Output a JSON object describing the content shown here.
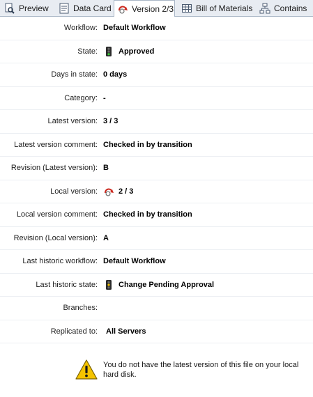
{
  "tabs": [
    {
      "label": "Preview",
      "icon": "preview-icon"
    },
    {
      "label": "Data Card",
      "icon": "data-card-icon"
    },
    {
      "label": "Version 2/3",
      "icon": "version-icon",
      "active": true
    },
    {
      "label": "Bill of Materials",
      "icon": "bom-table-icon"
    },
    {
      "label": "Contains",
      "icon": "contains-tree-icon"
    }
  ],
  "fields": {
    "workflow": {
      "label": "Workflow:",
      "value": "Default Workflow"
    },
    "state": {
      "label": "State:",
      "value": "Approved",
      "icon": "traffic-light-icon"
    },
    "days_in_state": {
      "label": "Days in state:",
      "value": "0 days"
    },
    "category": {
      "label": "Category:",
      "value": "-"
    },
    "latest_version": {
      "label": "Latest version:",
      "value": "3 / 3"
    },
    "latest_version_comment": {
      "label": "Latest version comment:",
      "value": "Checked in by transition"
    },
    "revision_latest": {
      "label": "Revision (Latest version):",
      "value": "B"
    },
    "local_version": {
      "label": "Local version:",
      "value": "2 / 3",
      "icon": "local-version-icon"
    },
    "local_version_comment": {
      "label": "Local version comment:",
      "value": "Checked in by transition"
    },
    "revision_local": {
      "label": "Revision (Local version):",
      "value": "A"
    },
    "last_historic_workflow": {
      "label": "Last historic workflow:",
      "value": "Default Workflow"
    },
    "last_historic_state": {
      "label": "Last historic state:",
      "value": "Change Pending Approval",
      "icon": "traffic-light-icon"
    },
    "branches": {
      "label": "Branches:",
      "value": ""
    },
    "replicated_to": {
      "label": "Replicated to:",
      "value": "All Servers"
    }
  },
  "warning": {
    "icon": "warning-icon",
    "text": "You do not have the latest version of this file on your local hard disk."
  },
  "colors": {
    "tab_bar_bg": "#e8ecf2",
    "tab_border": "#a9b6c6",
    "warning_yellow": "#f5c400",
    "version_red": "#cc2a1f"
  }
}
